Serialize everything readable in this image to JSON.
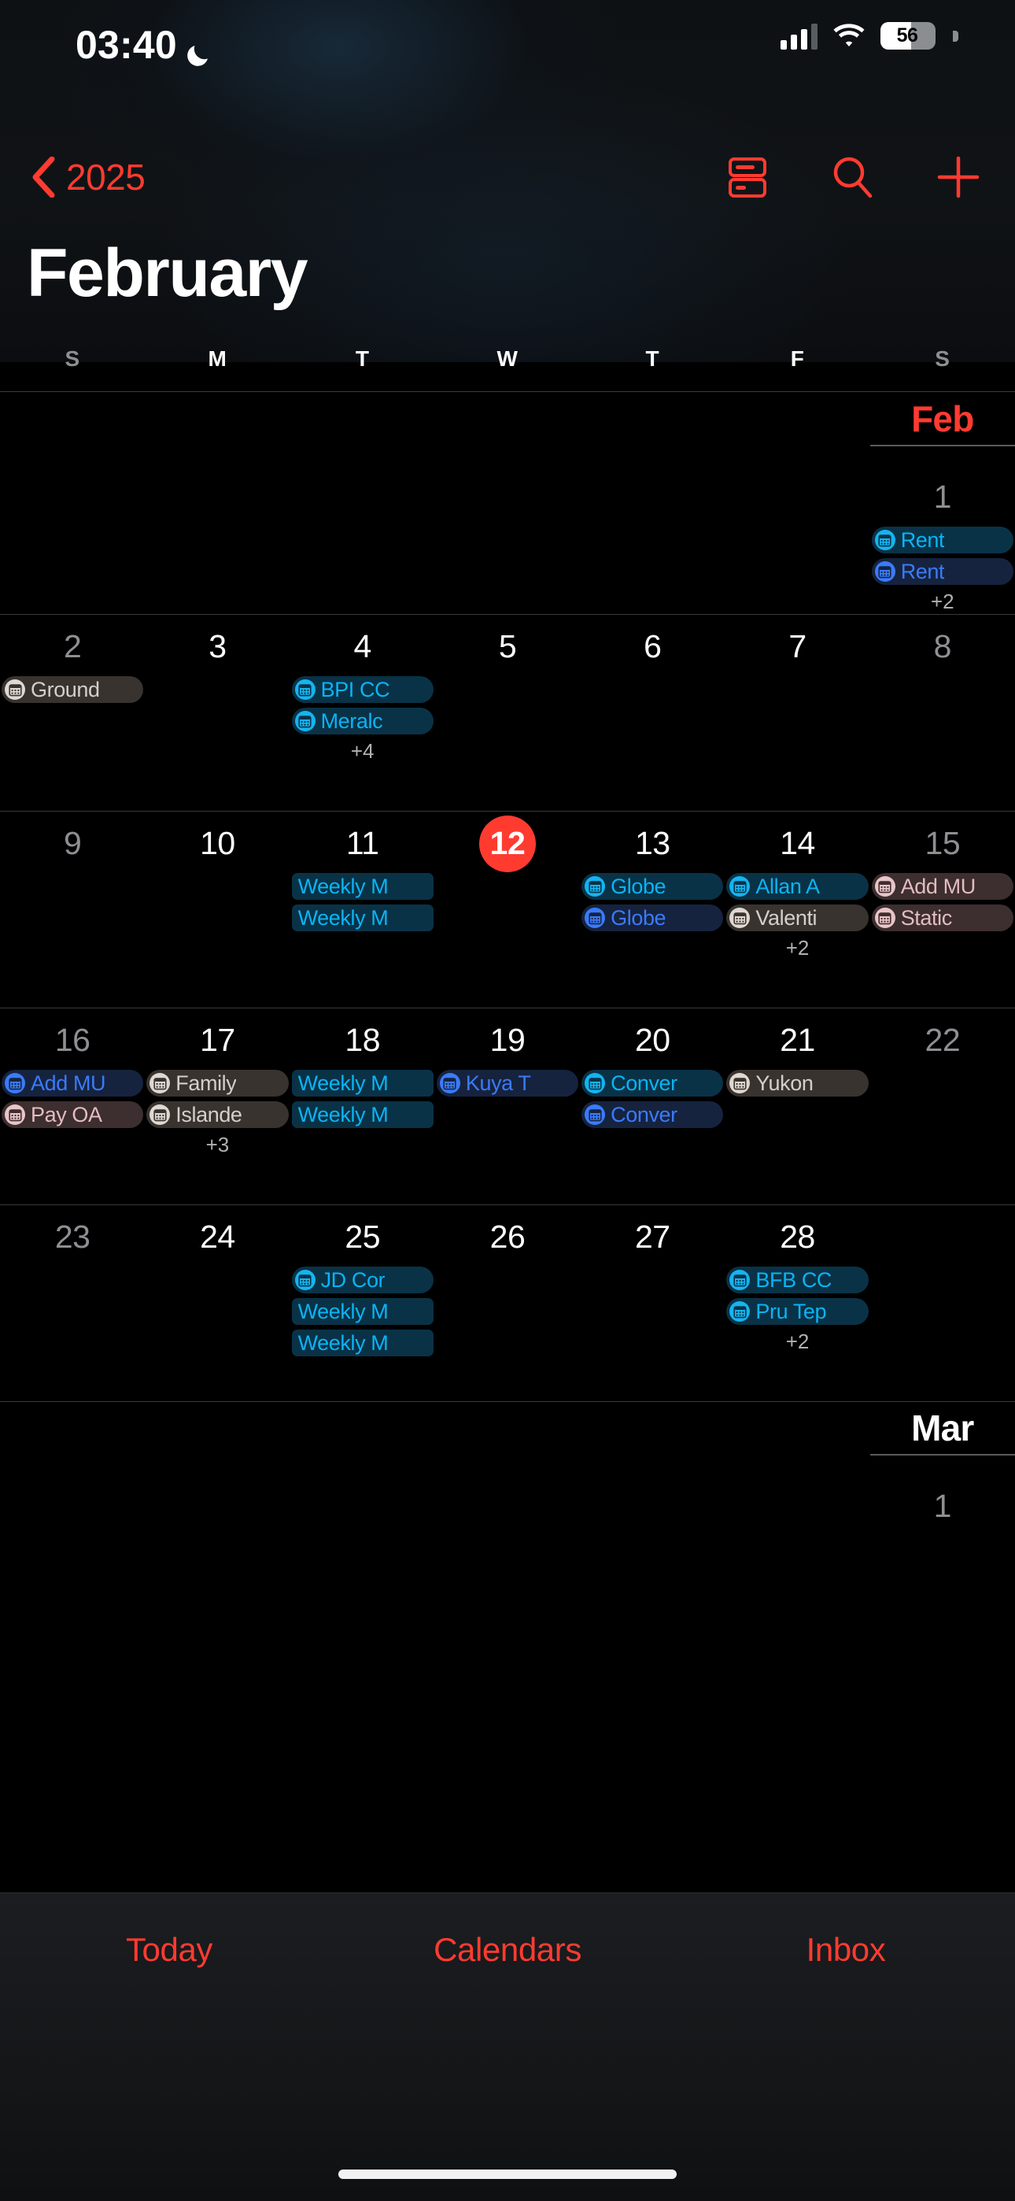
{
  "status_bar": {
    "time": "03:40",
    "moon_icon": "crescent-moon-icon",
    "cellular_icon": "cellular-signal-icon",
    "wifi_icon": "wifi-icon",
    "battery_percent": "56",
    "battery_level": 56
  },
  "nav": {
    "back_label": "2025",
    "back_icon": "chevron-left-icon",
    "list_view_icon": "list-view-icon",
    "search_icon": "search-icon",
    "add_icon": "plus-icon",
    "accent_color": "#ff3b30"
  },
  "page_title": "February",
  "weekdays": [
    {
      "label": "S",
      "dim": true
    },
    {
      "label": "M",
      "dim": false
    },
    {
      "label": "T",
      "dim": false
    },
    {
      "label": "W",
      "dim": false
    },
    {
      "label": "T",
      "dim": false
    },
    {
      "label": "F",
      "dim": false
    },
    {
      "label": "S",
      "dim": true
    }
  ],
  "calendar_colors": {
    "cyan": {
      "text": "#0ab4f5",
      "bg": "#0a3247",
      "dot": "#14b4f0"
    },
    "blue": {
      "text": "#3a7bfa",
      "bg": "#16233f",
      "dot": "#3a7bfa"
    },
    "white": {
      "text": "#d3cfcc",
      "bg": "#39332f",
      "dot": "#ded7d2"
    },
    "pink": {
      "text": "#e4bcc0",
      "bg": "#3d2e2f",
      "dot": "#e9c4c8"
    }
  },
  "weeks": [
    {
      "month_flag": {
        "label": "Feb",
        "style": "red",
        "column": 6
      },
      "days": [
        {
          "num": "",
          "dim": false,
          "today": false,
          "events": [],
          "overflow": ""
        },
        {
          "num": "",
          "dim": false,
          "today": false,
          "events": [],
          "overflow": ""
        },
        {
          "num": "",
          "dim": false,
          "today": false,
          "events": [],
          "overflow": ""
        },
        {
          "num": "",
          "dim": false,
          "today": false,
          "events": [],
          "overflow": ""
        },
        {
          "num": "",
          "dim": false,
          "today": false,
          "events": [],
          "overflow": ""
        },
        {
          "num": "",
          "dim": false,
          "today": false,
          "events": [],
          "overflow": ""
        },
        {
          "num": "1",
          "dim": true,
          "today": false,
          "events": [
            {
              "title": "Rent",
              "color": "cyan",
              "icon": true
            },
            {
              "title": "Rent",
              "color": "blue",
              "icon": true
            }
          ],
          "overflow": "+2"
        }
      ]
    },
    {
      "month_flag": null,
      "days": [
        {
          "num": "2",
          "dim": true,
          "today": false,
          "events": [
            {
              "title": "Ground",
              "color": "white",
              "icon": true
            }
          ],
          "overflow": ""
        },
        {
          "num": "3",
          "dim": false,
          "today": false,
          "events": [],
          "overflow": ""
        },
        {
          "num": "4",
          "dim": false,
          "today": false,
          "events": [
            {
              "title": "BPI CC",
              "color": "cyan",
              "icon": true
            },
            {
              "title": "Meralc",
              "color": "cyan",
              "icon": true
            }
          ],
          "overflow": "+4"
        },
        {
          "num": "5",
          "dim": false,
          "today": false,
          "events": [],
          "overflow": ""
        },
        {
          "num": "6",
          "dim": false,
          "today": false,
          "events": [],
          "overflow": ""
        },
        {
          "num": "7",
          "dim": false,
          "today": false,
          "events": [],
          "overflow": ""
        },
        {
          "num": "8",
          "dim": true,
          "today": false,
          "events": [],
          "overflow": ""
        }
      ]
    },
    {
      "month_flag": null,
      "days": [
        {
          "num": "9",
          "dim": true,
          "today": false,
          "events": [],
          "overflow": ""
        },
        {
          "num": "10",
          "dim": false,
          "today": false,
          "events": [],
          "overflow": ""
        },
        {
          "num": "11",
          "dim": false,
          "today": false,
          "events": [
            {
              "title": "Weekly M",
              "color": "cyan",
              "icon": false
            },
            {
              "title": "Weekly M",
              "color": "cyan",
              "icon": false
            }
          ],
          "overflow": ""
        },
        {
          "num": "12",
          "dim": false,
          "today": true,
          "events": [],
          "overflow": ""
        },
        {
          "num": "13",
          "dim": false,
          "today": false,
          "events": [
            {
              "title": "Globe",
              "color": "cyan",
              "icon": true
            },
            {
              "title": "Globe",
              "color": "blue",
              "icon": true
            }
          ],
          "overflow": ""
        },
        {
          "num": "14",
          "dim": false,
          "today": false,
          "events": [
            {
              "title": "Allan A",
              "color": "cyan",
              "icon": true
            },
            {
              "title": "Valenti",
              "color": "white",
              "icon": true
            }
          ],
          "overflow": "+2"
        },
        {
          "num": "15",
          "dim": true,
          "today": false,
          "events": [
            {
              "title": "Add MU",
              "color": "pink",
              "icon": true
            },
            {
              "title": "Static",
              "color": "pink",
              "icon": true
            }
          ],
          "overflow": ""
        }
      ]
    },
    {
      "month_flag": null,
      "days": [
        {
          "num": "16",
          "dim": true,
          "today": false,
          "events": [
            {
              "title": "Add MU",
              "color": "blue",
              "icon": true
            },
            {
              "title": "Pay OA",
              "color": "pink",
              "icon": true
            }
          ],
          "overflow": ""
        },
        {
          "num": "17",
          "dim": false,
          "today": false,
          "events": [
            {
              "title": "Family",
              "color": "white",
              "icon": true
            },
            {
              "title": "Islande",
              "color": "white",
              "icon": true
            }
          ],
          "overflow": "+3"
        },
        {
          "num": "18",
          "dim": false,
          "today": false,
          "events": [
            {
              "title": "Weekly M",
              "color": "cyan",
              "icon": false
            },
            {
              "title": "Weekly M",
              "color": "cyan",
              "icon": false
            }
          ],
          "overflow": ""
        },
        {
          "num": "19",
          "dim": false,
          "today": false,
          "events": [
            {
              "title": "Kuya T",
              "color": "blue",
              "icon": true
            }
          ],
          "overflow": ""
        },
        {
          "num": "20",
          "dim": false,
          "today": false,
          "events": [
            {
              "title": "Conver",
              "color": "cyan",
              "icon": true
            },
            {
              "title": "Conver",
              "color": "blue",
              "icon": true
            }
          ],
          "overflow": ""
        },
        {
          "num": "21",
          "dim": false,
          "today": false,
          "events": [
            {
              "title": "Yukon",
              "color": "white",
              "icon": true
            }
          ],
          "overflow": ""
        },
        {
          "num": "22",
          "dim": true,
          "today": false,
          "events": [],
          "overflow": ""
        }
      ]
    },
    {
      "month_flag": null,
      "days": [
        {
          "num": "23",
          "dim": true,
          "today": false,
          "events": [],
          "overflow": ""
        },
        {
          "num": "24",
          "dim": false,
          "today": false,
          "events": [],
          "overflow": ""
        },
        {
          "num": "25",
          "dim": false,
          "today": false,
          "events": [
            {
              "title": "JD Cor",
              "color": "cyan",
              "icon": true
            },
            {
              "title": "Weekly M",
              "color": "cyan",
              "icon": false
            },
            {
              "title": "Weekly M",
              "color": "cyan",
              "icon": false
            }
          ],
          "overflow": ""
        },
        {
          "num": "26",
          "dim": false,
          "today": false,
          "events": [],
          "overflow": ""
        },
        {
          "num": "27",
          "dim": false,
          "today": false,
          "events": [],
          "overflow": ""
        },
        {
          "num": "28",
          "dim": false,
          "today": false,
          "events": [
            {
              "title": "BFB CC",
              "color": "cyan",
              "icon": true
            },
            {
              "title": "Pru Tep",
              "color": "cyan",
              "icon": true
            }
          ],
          "overflow": "+2"
        },
        {
          "num": "",
          "dim": false,
          "today": false,
          "events": [],
          "overflow": ""
        }
      ]
    },
    {
      "month_flag": {
        "label": "Mar",
        "style": "white",
        "column": 6
      },
      "days": [
        {
          "num": "",
          "dim": false,
          "today": false,
          "events": [],
          "overflow": ""
        },
        {
          "num": "",
          "dim": false,
          "today": false,
          "events": [],
          "overflow": ""
        },
        {
          "num": "",
          "dim": false,
          "today": false,
          "events": [],
          "overflow": ""
        },
        {
          "num": "",
          "dim": false,
          "today": false,
          "events": [],
          "overflow": ""
        },
        {
          "num": "",
          "dim": false,
          "today": false,
          "events": [],
          "overflow": ""
        },
        {
          "num": "",
          "dim": false,
          "today": false,
          "events": [],
          "overflow": ""
        },
        {
          "num": "1",
          "dim": true,
          "today": false,
          "events": [],
          "overflow": ""
        }
      ]
    }
  ],
  "toolbar": {
    "today_label": "Today",
    "calendars_label": "Calendars",
    "inbox_label": "Inbox"
  }
}
